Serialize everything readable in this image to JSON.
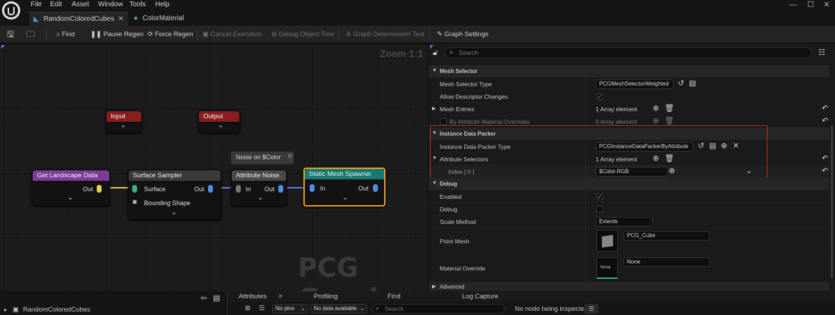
{
  "menu": {
    "file": "File",
    "edit": "Edit",
    "asset": "Asset",
    "window": "Window",
    "tools": "Tools",
    "help": "Help"
  },
  "tabs": [
    {
      "label": "RandomColoredCubes"
    },
    {
      "label": "ColorMaterial"
    }
  ],
  "toolbar": {
    "find": "Find",
    "pause_regen": "Pause Regen",
    "force_regen": "Force Regen",
    "cancel_execution": "Cancel Execution",
    "debug_object_tree": "Debug Object Tree",
    "graph_determinism_test": "Graph Determinism Test",
    "graph_settings": "Graph Settings"
  },
  "graph": {
    "zoom": "Zoom 1:1",
    "watermark": "PCG Graph",
    "comment": "Noise on $Color",
    "nodes": {
      "input": {
        "title": "Input",
        "color": "#8a1e1e"
      },
      "output": {
        "title": "Output",
        "color": "#8a1e1e"
      },
      "landscape": {
        "title": "Get Landscape Data",
        "out": "Out",
        "color": "#7d3c98"
      },
      "sampler": {
        "title": "Surface Sampler",
        "in": "Surface",
        "out": "Out",
        "bounding": "Bounding Shape",
        "color": "#3a3a3a"
      },
      "noise": {
        "title": "Attribute Noise",
        "in": "In",
        "out": "Out",
        "color": "#4a4a4a"
      },
      "spawner": {
        "title": "Static Mesh Spawner",
        "in": "In",
        "out": "Out",
        "color": "#177a72"
      }
    }
  },
  "details": {
    "search_placeholder": "Search",
    "mesh_selector": {
      "header": "Mesh Selector",
      "type_label": "Mesh Selector Type",
      "type_value": "PCGMeshSelectorWeighted",
      "allow_label": "Allow Descriptor Changes",
      "entries_label": "Mesh Entries",
      "entries_value": "1 Array element",
      "overrides_label": "By Attribute Material Overrides",
      "overrides_value": "0 Array element"
    },
    "instance_packer": {
      "header": "Instance Data Packer",
      "type_label": "Instance Data Packer Type",
      "type_value": "PCGInstanceDataPackerByAttribute",
      "selectors_label": "Attribute Selectors",
      "selectors_value": "1 Array element",
      "index_label": "Index [ 0 ]",
      "index_value": "$Color.RGB"
    },
    "debug": {
      "header": "Debug",
      "enabled_label": "Enabled",
      "debug_label": "Debug",
      "scale_label": "Scale Method",
      "scale_value": "Extents",
      "mesh_label": "Point Mesh",
      "mesh_value": "PCG_Cube",
      "material_label": "Material Override",
      "material_value": "None",
      "material_thumb": "None",
      "advanced": "Advanced"
    }
  },
  "bottom": {
    "tree_root": "RandomColoredCubes",
    "tabs": [
      "Attributes",
      "Profiling",
      "Find",
      "Log Capture"
    ],
    "pins_filter": "No pins",
    "data_filter": "No data available",
    "search_placeholder": "Search",
    "inspect_status": "No node being inspected"
  },
  "colors": {
    "highlight": "#c62828",
    "accent": "#4f8fe8",
    "select": "#f0a020"
  }
}
